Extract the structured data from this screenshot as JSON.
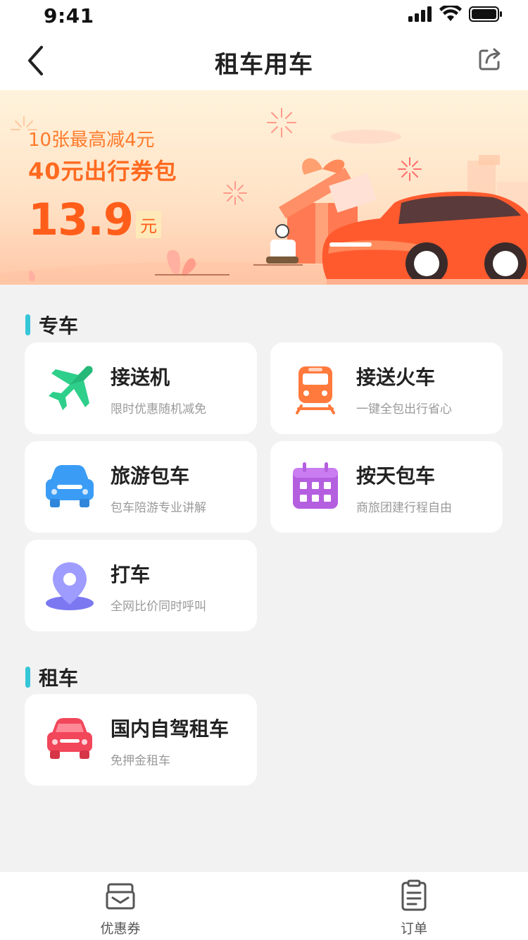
{
  "status_bar": {
    "time": "9:41"
  },
  "nav": {
    "title": "租车用车"
  },
  "banner": {
    "line1": "10张最高减4元",
    "line2": "40元出行券包",
    "price": "13.9",
    "price_unit": "元"
  },
  "sections": {
    "special": {
      "title": "专车",
      "items": [
        {
          "title": "接送机",
          "subtitle": "限时优惠随机减免",
          "icon": "airplane-icon"
        },
        {
          "title": "接送火车",
          "subtitle": "一键全包出行省心",
          "icon": "train-icon"
        },
        {
          "title": "旅游包车",
          "subtitle": "包车陪游专业讲解",
          "icon": "car-icon"
        },
        {
          "title": "按天包车",
          "subtitle": "商旅团建行程自由",
          "icon": "calendar-icon"
        },
        {
          "title": "打车",
          "subtitle": "全网比价同时呼叫",
          "icon": "location-pin-icon"
        }
      ]
    },
    "rental": {
      "title": "租车",
      "items": [
        {
          "title": "国内自驾租车",
          "subtitle": "免押金租车",
          "icon": "car-icon"
        }
      ]
    }
  },
  "tab_bar": {
    "tabs": [
      {
        "label": "优惠券",
        "icon": "coupon-icon"
      },
      {
        "label": "订单",
        "icon": "order-icon"
      }
    ]
  },
  "colors": {
    "accent_bar": "#35c6d8",
    "banner_orange": "#ff6a20",
    "plane_green": "#2ecf8a",
    "train_orange": "#ff7a3c",
    "car_blue": "#3b9cf5",
    "calendar_purple": "#b45fe0",
    "pin_indigo": "#7b78f2",
    "rental_red": "#f2465a"
  }
}
